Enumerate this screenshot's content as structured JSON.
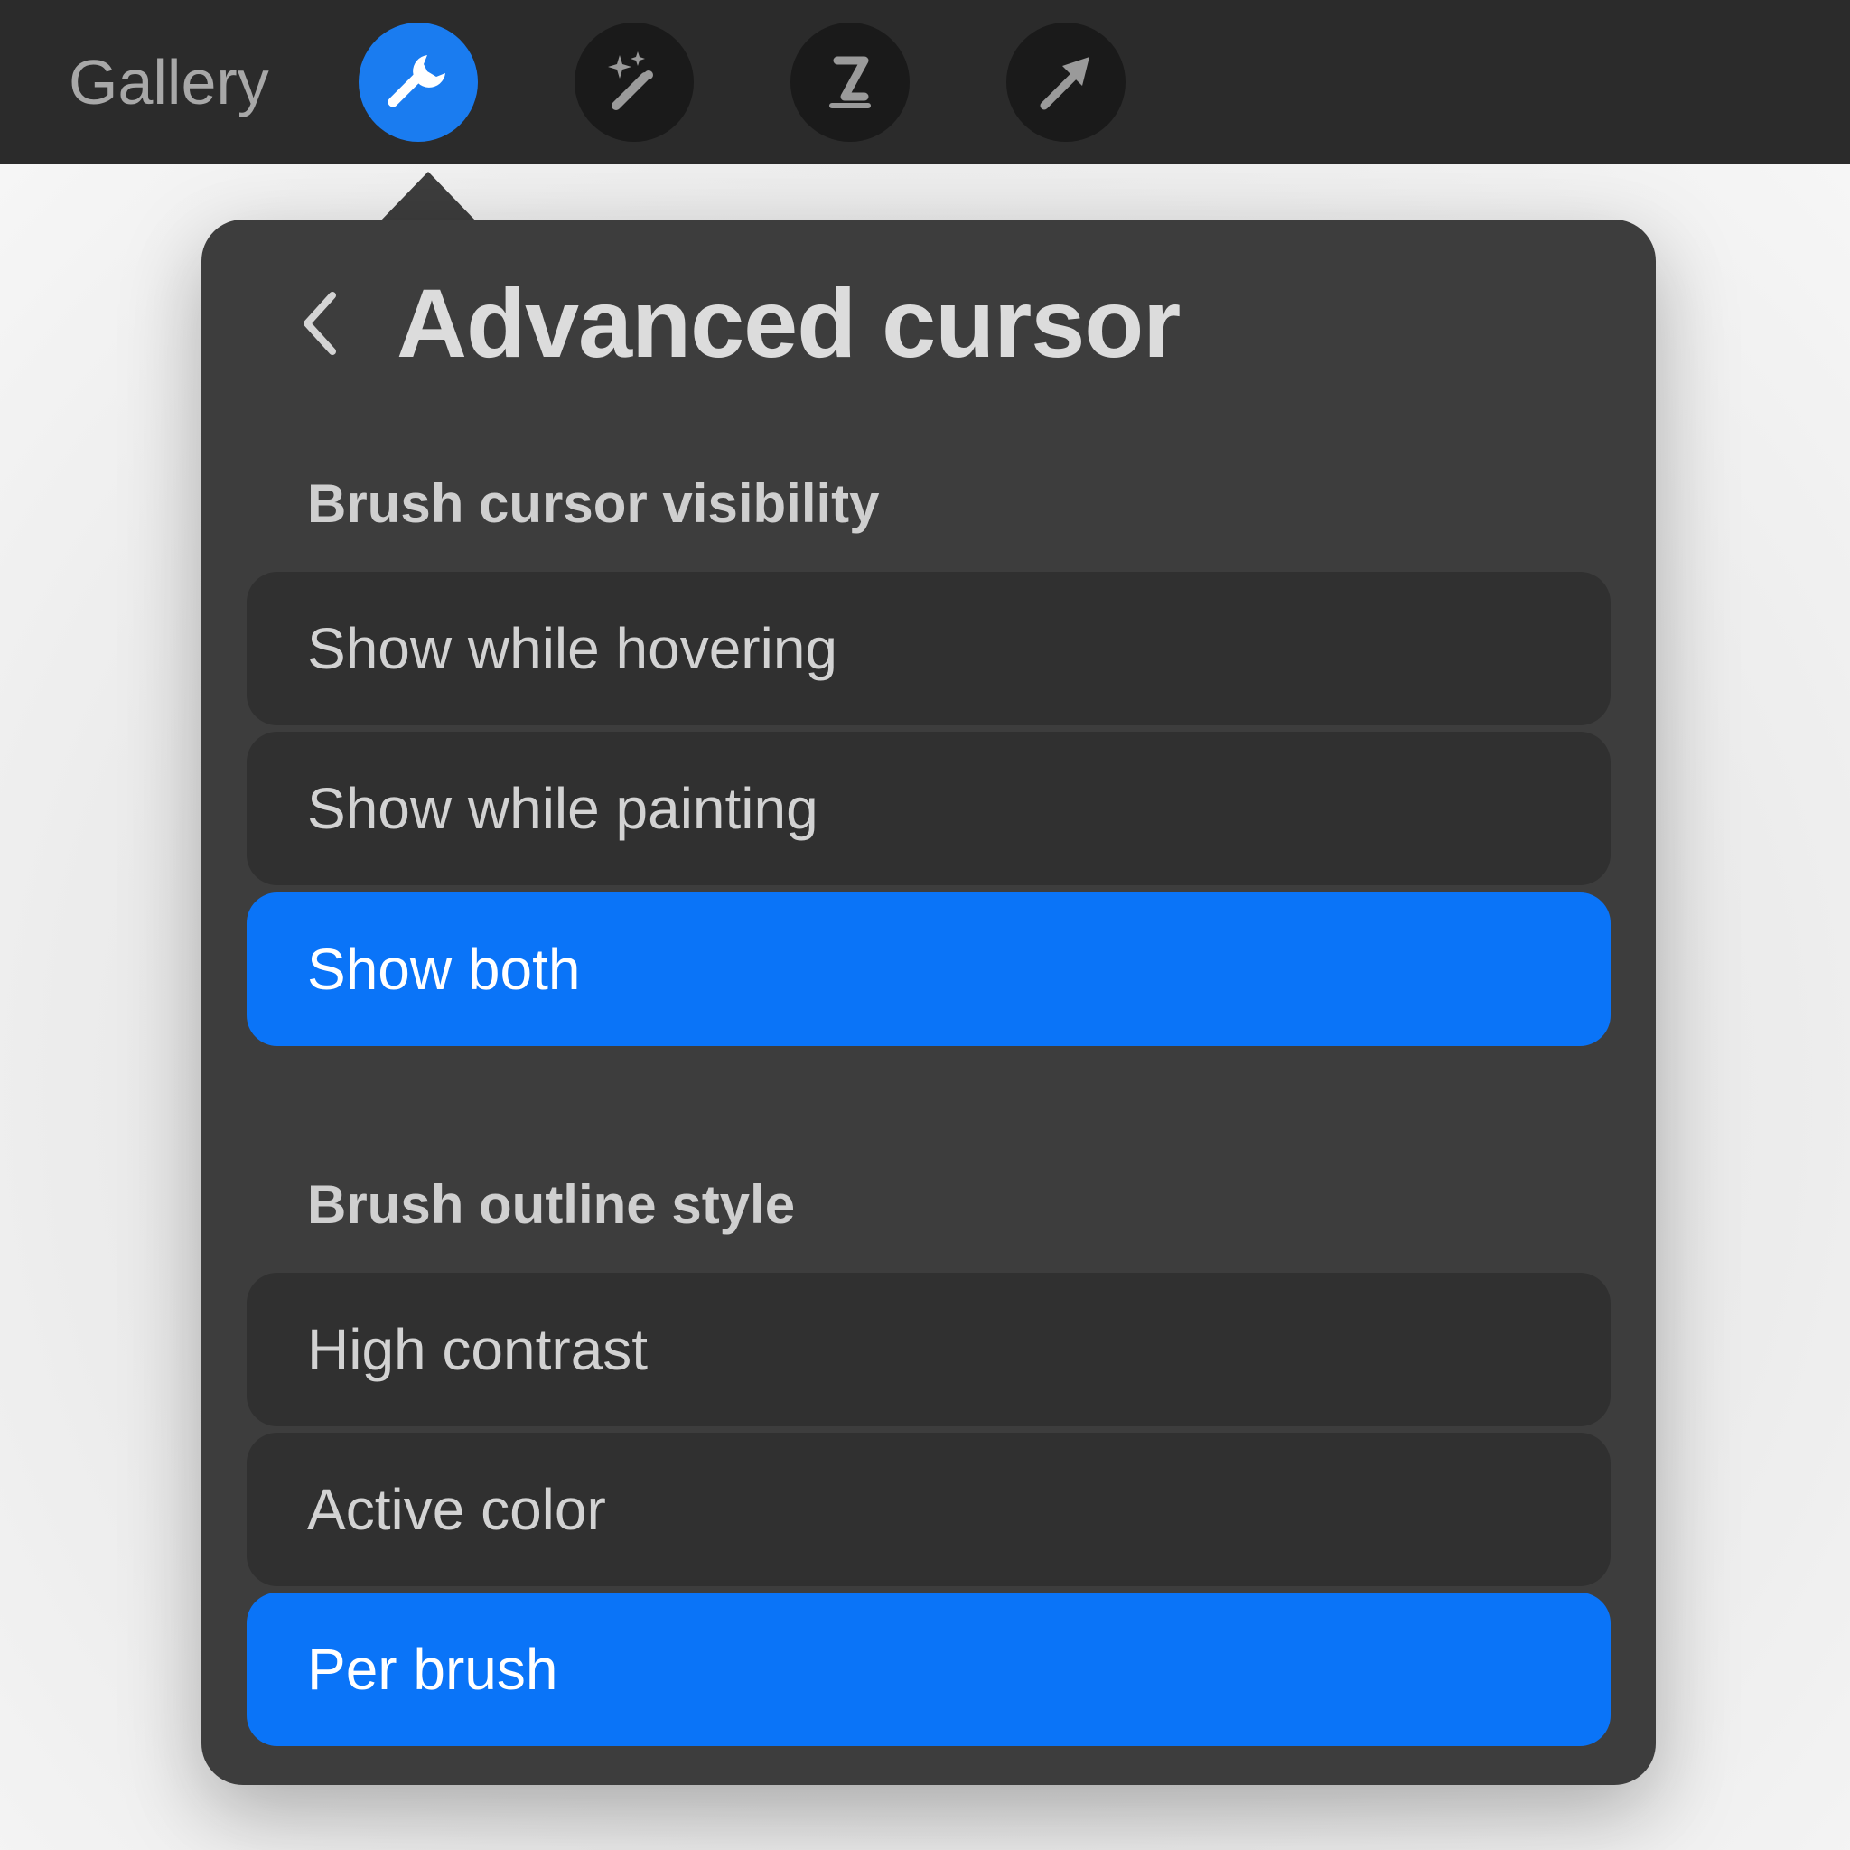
{
  "toolbar": {
    "gallery_label": "Gallery",
    "tools": [
      {
        "icon": "wrench-icon",
        "active": true
      },
      {
        "icon": "magic-wand-icon",
        "active": false
      },
      {
        "icon": "selection-s-icon",
        "active": false
      },
      {
        "icon": "transform-arrow-icon",
        "active": false
      }
    ]
  },
  "popover": {
    "title": "Advanced cursor",
    "sections": [
      {
        "title": "Brush cursor visibility",
        "options": [
          {
            "label": "Show while hovering",
            "selected": false
          },
          {
            "label": "Show while painting",
            "selected": false
          },
          {
            "label": "Show both",
            "selected": true
          }
        ]
      },
      {
        "title": "Brush outline style",
        "options": [
          {
            "label": "High contrast",
            "selected": false
          },
          {
            "label": "Active color",
            "selected": false
          },
          {
            "label": "Per brush",
            "selected": true
          }
        ]
      }
    ]
  },
  "colors": {
    "accent": "#0a74f8",
    "toolbar_bg": "#2b2b2b",
    "panel_bg": "#3d3d3d",
    "option_bg": "#303030"
  }
}
